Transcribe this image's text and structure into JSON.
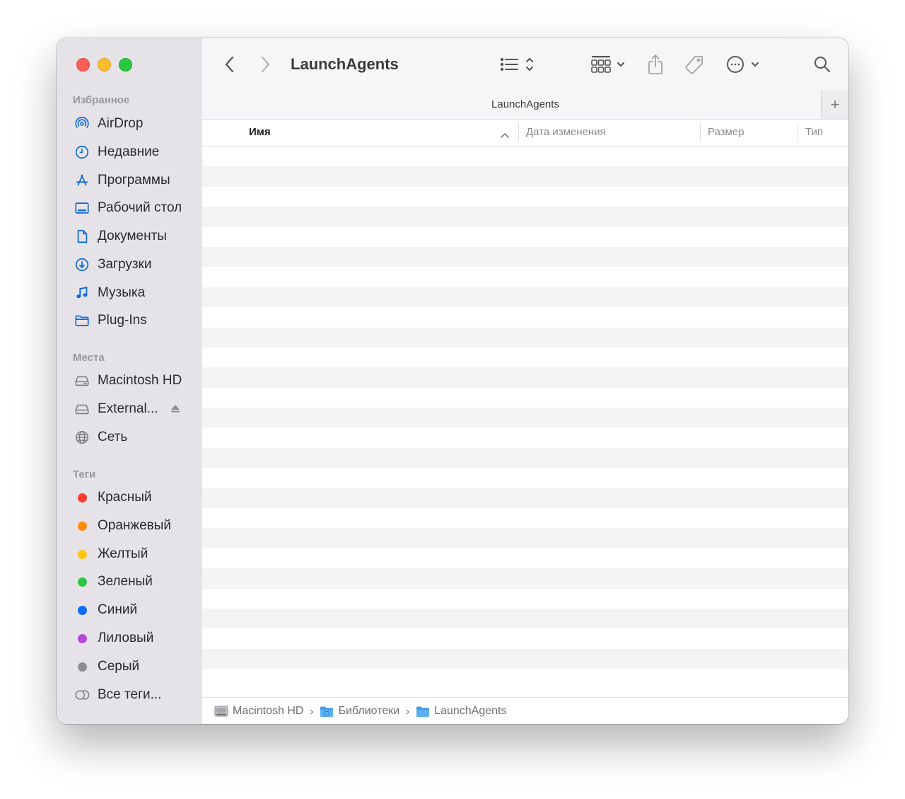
{
  "window": {
    "traffic_lights": [
      "close",
      "minimize",
      "zoom"
    ]
  },
  "sidebar": {
    "favorites_title": "Избранное",
    "favorites": [
      {
        "label": "AirDrop",
        "icon": "airdrop-icon"
      },
      {
        "label": "Недавние",
        "icon": "clock-icon"
      },
      {
        "label": "Программы",
        "icon": "applications-icon"
      },
      {
        "label": "Рабочий стол",
        "icon": "desktop-icon"
      },
      {
        "label": "Документы",
        "icon": "document-icon"
      },
      {
        "label": "Загрузки",
        "icon": "download-icon"
      },
      {
        "label": "Музыка",
        "icon": "music-icon"
      },
      {
        "label": "Plug-Ins",
        "icon": "folder-icon"
      }
    ],
    "locations_title": "Места",
    "locations": [
      {
        "label": "Macintosh HD",
        "icon": "drive-icon"
      },
      {
        "label": "External...",
        "icon": "drive-icon",
        "eject": true
      },
      {
        "label": "Сеть",
        "icon": "network-icon"
      }
    ],
    "tags_title": "Теги",
    "tags": [
      {
        "label": "Красный",
        "color": "#fe3b30"
      },
      {
        "label": "Оранжевый",
        "color": "#fe8a0c"
      },
      {
        "label": "Желтый",
        "color": "#fdc60b"
      },
      {
        "label": "Зеленый",
        "color": "#2dc640"
      },
      {
        "label": "Синий",
        "color": "#0b6cfe"
      },
      {
        "label": "Лиловый",
        "color": "#b547dd"
      },
      {
        "label": "Серый",
        "color": "#8e8d92"
      },
      {
        "label": "Все теги...",
        "color": null
      }
    ]
  },
  "toolbar": {
    "title": "LaunchAgents"
  },
  "tab": {
    "label": "LaunchAgents",
    "add_label": "+"
  },
  "columns": {
    "name": "Имя",
    "modified": "Дата изменения",
    "size": "Размер",
    "kind": "Тип"
  },
  "pathbar": {
    "crumbs": [
      "Macintosh HD",
      "Библиотеки",
      "LaunchAgents"
    ],
    "separator": "›"
  },
  "colors": {
    "accent": "#0a67e0",
    "sidebar_bg": "#e6e3e8"
  }
}
